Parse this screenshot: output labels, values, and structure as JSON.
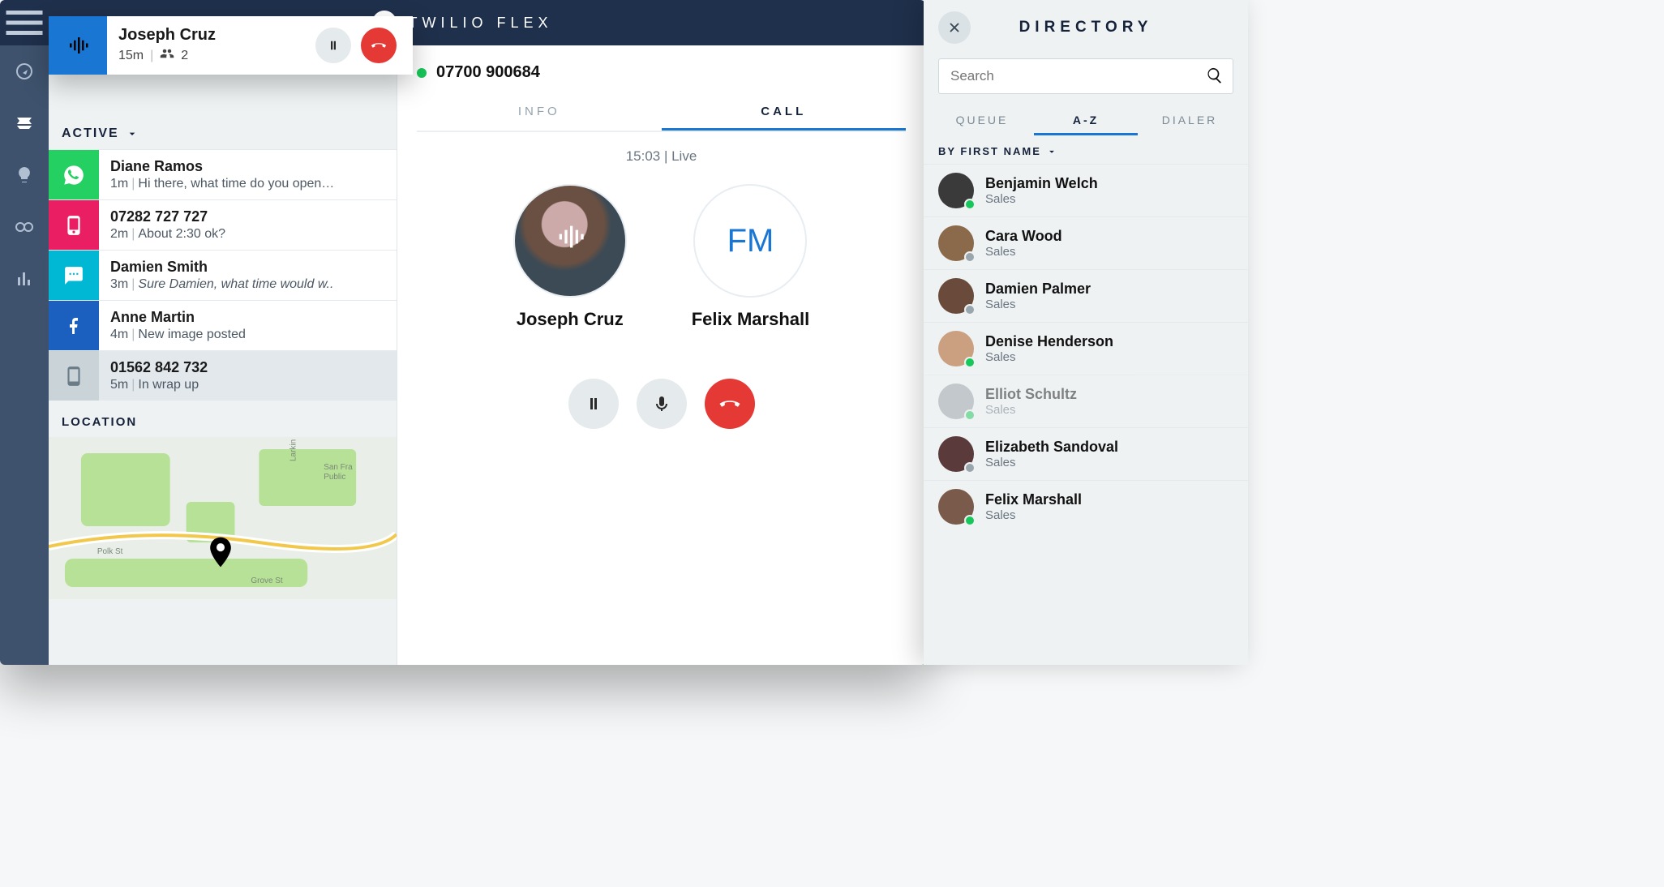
{
  "header": {
    "title": "TWILIO FLEX"
  },
  "activeCall": {
    "name": "Joseph Cruz",
    "duration": "15m",
    "participants": "2"
  },
  "tasks": {
    "section": "ACTIVE",
    "items": [
      {
        "channel": "whatsapp",
        "title": "Diane Ramos",
        "time": "1m",
        "preview": "Hi there, what time do you open…",
        "italic": false
      },
      {
        "channel": "sms",
        "title": "07282 727 727",
        "time": "2m",
        "preview": "About 2:30 ok?",
        "italic": false
      },
      {
        "channel": "chat",
        "title": "Damien Smith",
        "time": "3m",
        "preview": "Sure Damien, what time would w..",
        "italic": true
      },
      {
        "channel": "facebook",
        "title": "Anne Martin",
        "time": "4m",
        "preview": "New image posted",
        "italic": false
      },
      {
        "channel": "voice-idle",
        "title": "01562 842 732",
        "time": "5m",
        "preview": "In wrap up",
        "italic": false
      }
    ]
  },
  "location": {
    "heading": "LOCATION"
  },
  "main": {
    "number": "07700 900684",
    "tabs": {
      "info": "INFO",
      "call": "CALL"
    },
    "timer": "15:03 | Live",
    "participantA": "Joseph Cruz",
    "participantB": "Felix Marshall",
    "initialsB": "FM"
  },
  "directory": {
    "title": "DIRECTORY",
    "search_placeholder": "Search",
    "tabs": {
      "queue": "QUEUE",
      "az": "A-Z",
      "dialer": "DIALER"
    },
    "sort": "BY FIRST NAME",
    "items": [
      {
        "name": "Benjamin Welch",
        "sub": "Sales",
        "presence": "green"
      },
      {
        "name": "Cara Wood",
        "sub": "Sales",
        "presence": "gray"
      },
      {
        "name": "Damien Palmer",
        "sub": "Sales",
        "presence": "gray"
      },
      {
        "name": "Denise Henderson",
        "sub": "Sales",
        "presence": "green"
      },
      {
        "name": "Elliot Schultz",
        "sub": "Sales",
        "presence": "green",
        "dim": true
      },
      {
        "name": "Elizabeth Sandoval",
        "sub": "Sales",
        "presence": "gray"
      },
      {
        "name": "Felix Marshall",
        "sub": "Sales",
        "presence": "green"
      }
    ]
  }
}
